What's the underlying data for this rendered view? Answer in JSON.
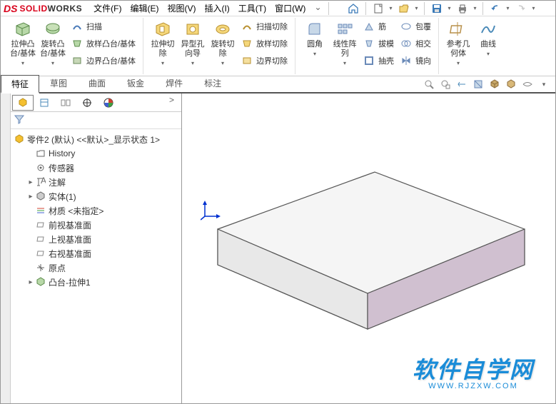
{
  "logo": {
    "ds": "DS",
    "solid": "SOLID",
    "works": "WORKS"
  },
  "menus": [
    {
      "label": "文件(F)"
    },
    {
      "label": "编辑(E)"
    },
    {
      "label": "视图(V)"
    },
    {
      "label": "插入(I)"
    },
    {
      "label": "工具(T)"
    },
    {
      "label": "窗口(W)"
    }
  ],
  "menuDropdown": "⌄",
  "ribbon": {
    "extrudeBoss": "拉伸凸\n台/基体",
    "revolveBoss": "旋转凸\n台/基体",
    "sweep": "扫描",
    "loft": "放样凸台/基体",
    "boundary": "边界凸台/基体",
    "extrudeCut": "拉伸切\n除",
    "holeWiz": "异型孔\n向导",
    "revolveCut": "旋转切\n除",
    "sweepCut": "扫描切除",
    "loftCut": "放样切除",
    "boundaryCut": "边界切除",
    "fillet": "圆角",
    "linPattern": "线性阵\n列",
    "rib": "筋",
    "draft": "拔模",
    "shell": "抽壳",
    "wrap": "包覆",
    "intersect": "相交",
    "mirror": "镜向",
    "refGeom": "参考几\n何体",
    "curves": "曲线"
  },
  "tabs": [
    {
      "label": "特征",
      "active": true
    },
    {
      "label": "草图"
    },
    {
      "label": "曲面"
    },
    {
      "label": "钣金"
    },
    {
      "label": "焊件"
    },
    {
      "label": "标注"
    }
  ],
  "tree": {
    "root": "零件2 (默认) <<默认>_显示状态 1>",
    "nodes": [
      {
        "label": "History",
        "icon": "folder"
      },
      {
        "label": "传感器",
        "icon": "sensor"
      },
      {
        "label": "注解",
        "icon": "annotation",
        "expandable": true
      },
      {
        "label": "实体(1)",
        "icon": "solid",
        "expandable": true
      },
      {
        "label": "材质 <未指定>",
        "icon": "material"
      },
      {
        "label": "前视基准面",
        "icon": "plane"
      },
      {
        "label": "上视基准面",
        "icon": "plane"
      },
      {
        "label": "右视基准面",
        "icon": "plane"
      },
      {
        "label": "原点",
        "icon": "origin"
      },
      {
        "label": "凸台-拉伸1",
        "icon": "extrude",
        "expandable": true
      }
    ]
  },
  "watermark": {
    "main": "软件自学网",
    "sub": "WWW.RJZXW.COM"
  }
}
